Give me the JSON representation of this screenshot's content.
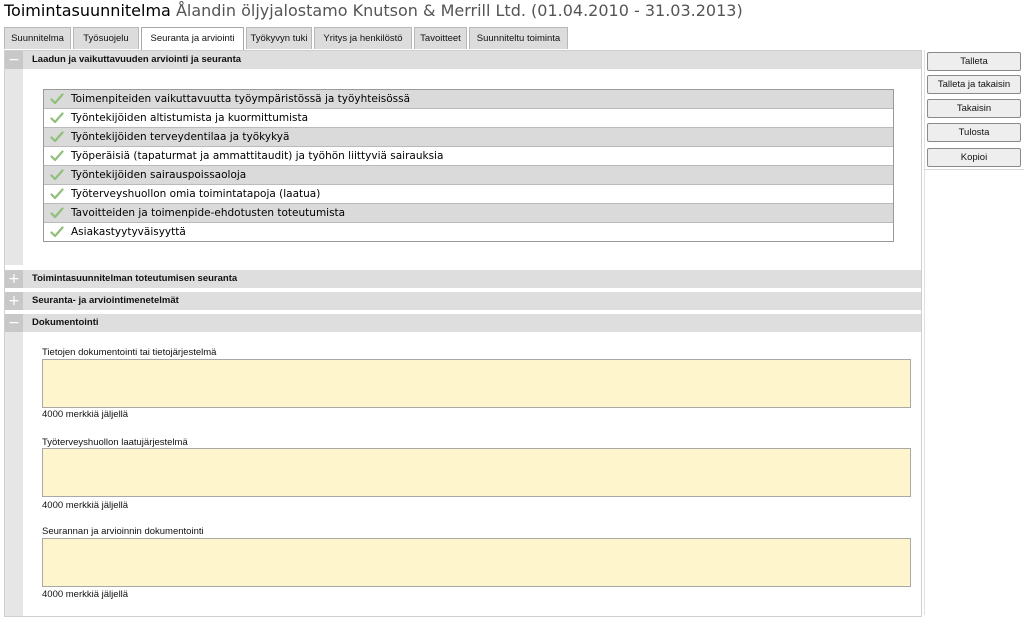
{
  "header": {
    "title": "Toimintasuunnitelma",
    "subtitle": "Ålandin öljyjalostamo Knutson & Merrill Ltd. (01.04.2010 - 31.03.2013)"
  },
  "tabs": [
    {
      "label": "Suunnitelma"
    },
    {
      "label": "Työsuojelu"
    },
    {
      "label": "Seuranta ja arviointi",
      "active": true
    },
    {
      "label": "Työkyvyn tuki"
    },
    {
      "label": "Yritys ja henkilöstö"
    },
    {
      "label": "Tavoitteet"
    },
    {
      "label": "Suunniteltu toiminta"
    }
  ],
  "sections": {
    "quality": {
      "label": "Laadun ja vaikuttavuuden arviointi ja seuranta",
      "toggle": "−"
    },
    "implementation": {
      "label": "Toimintasuunnitelman toteutumisen seuranta",
      "toggle": "+"
    },
    "methods": {
      "label": "Seuranta- ja arviointimenetelmät",
      "toggle": "+"
    },
    "documentation": {
      "label": "Dokumentointi",
      "toggle": "−"
    }
  },
  "checklist": [
    {
      "label": "Toimenpiteiden vaikuttavuutta työympäristössä ja työyhteisössä",
      "checked": true
    },
    {
      "label": "Työntekijöiden altistumista ja kuormittumista",
      "checked": true
    },
    {
      "label": "Työntekijöiden terveydentilaa ja työkykyä",
      "checked": true
    },
    {
      "label": "Työperäisiä (tapaturmat ja ammattitaudit) ja työhön liittyviä sairauksia",
      "checked": true
    },
    {
      "label": "Työntekijöiden sairauspoissaoloja",
      "checked": true
    },
    {
      "label": "Työterveyshuollon omia toimintatapoja (laatua)",
      "checked": true
    },
    {
      "label": "Tavoitteiden ja toimenpide-ehdotusten toteutumista",
      "checked": true
    },
    {
      "label": "Asiakastyytyväisyyttä",
      "checked": true
    }
  ],
  "documentation_fields": [
    {
      "label": "Tietojen dokumentointi tai tietojärjestelmä",
      "value": "",
      "counter": "4000 merkkiä jäljellä"
    },
    {
      "label": "Työterveyshuollon laatujärjestelmä",
      "value": "",
      "counter": "4000 merkkiä jäljellä"
    },
    {
      "label": "Seurannan ja arvioinnin dokumentointi",
      "value": "",
      "counter": "4000 merkkiä jäljellä"
    }
  ],
  "actions": {
    "save": "Talleta",
    "save_back": "Talleta ja takaisin",
    "back": "Takaisin",
    "print": "Tulosta",
    "copy": "Kopioi"
  },
  "colors": {
    "row_grey": "#dadada",
    "section_head": "#dedede",
    "textarea_bg": "#fff5cc",
    "check_green": "#8fbf7a"
  },
  "icons": {
    "check": "check-icon",
    "expand": "plus-icon",
    "collapse": "minus-icon"
  }
}
